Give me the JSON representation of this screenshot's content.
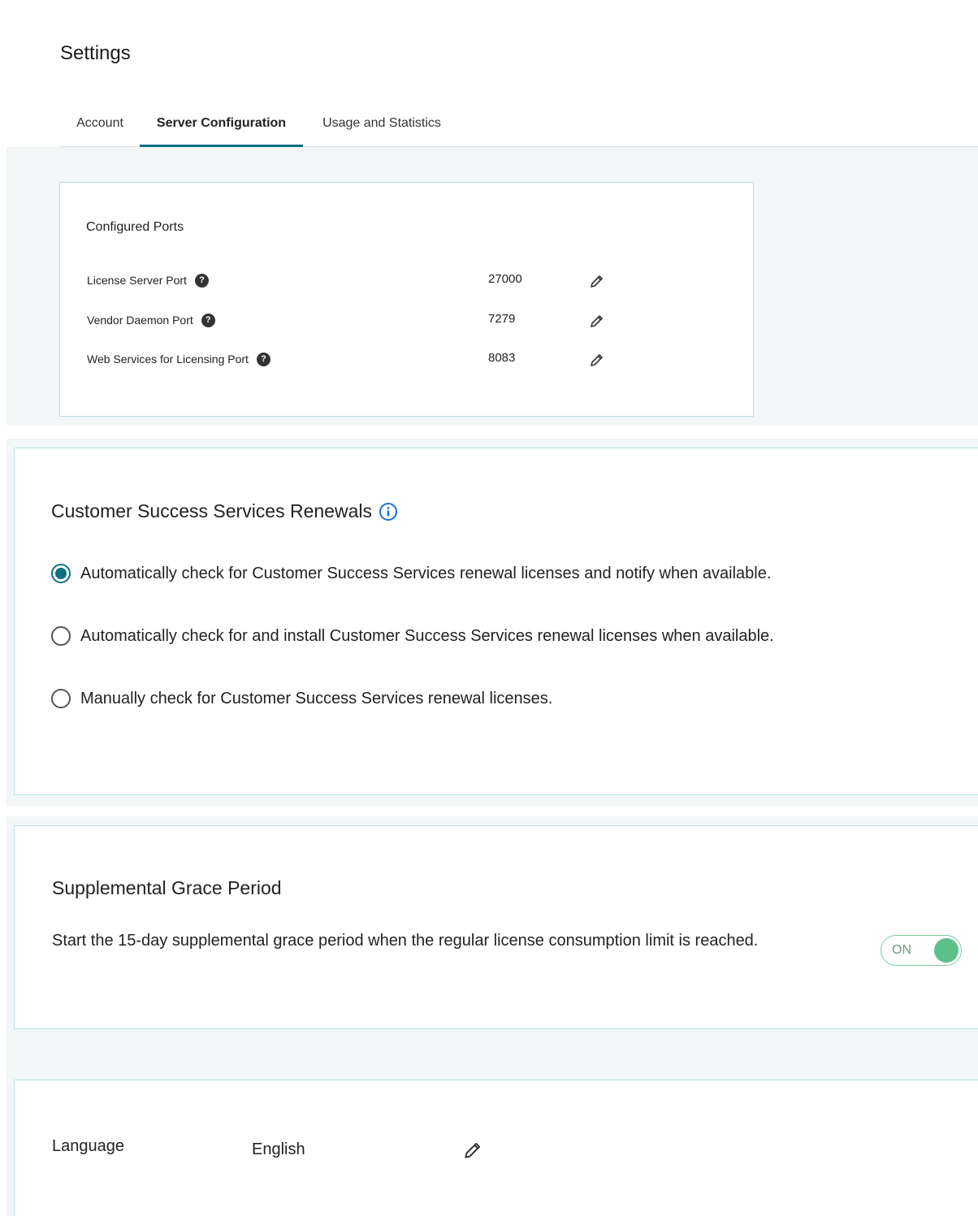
{
  "header": {
    "title": "Settings",
    "tabs": [
      {
        "label": "Account",
        "active": false
      },
      {
        "label": "Server Configuration",
        "active": true
      },
      {
        "label": "Usage and Statistics",
        "active": false
      }
    ]
  },
  "ports": {
    "title": "Configured Ports",
    "rows": [
      {
        "label": "License Server Port",
        "value": "27000"
      },
      {
        "label": "Vendor Daemon Port",
        "value": "7279"
      },
      {
        "label": "Web Services for Licensing Port",
        "value": "8083"
      }
    ],
    "help_glyph": "?"
  },
  "css_renewals": {
    "title": "Customer Success Services Renewals",
    "selected_index": 0,
    "options": [
      "Automatically check for Customer Success Services renewal licenses and notify when available.",
      "Automatically check for and install Customer Success Services renewal licenses when available.",
      "Manually check for Customer Success Services renewal licenses."
    ]
  },
  "grace_period": {
    "title": "Supplemental Grace Period",
    "description": "Start the 15-day supplemental grace period when the regular license consumption limit is reached.",
    "toggle_label": "ON",
    "toggle_on": true
  },
  "language": {
    "label": "Language",
    "value": "English"
  },
  "colors": {
    "accent": "#0e6f7e",
    "card_border": "#b8e0e6",
    "band_bg": "#f3f6f7",
    "toggle_on": "#5cc089"
  },
  "icons": {
    "edit": "pencil-icon",
    "help": "question-circle-icon",
    "info": "info-circle-icon"
  }
}
